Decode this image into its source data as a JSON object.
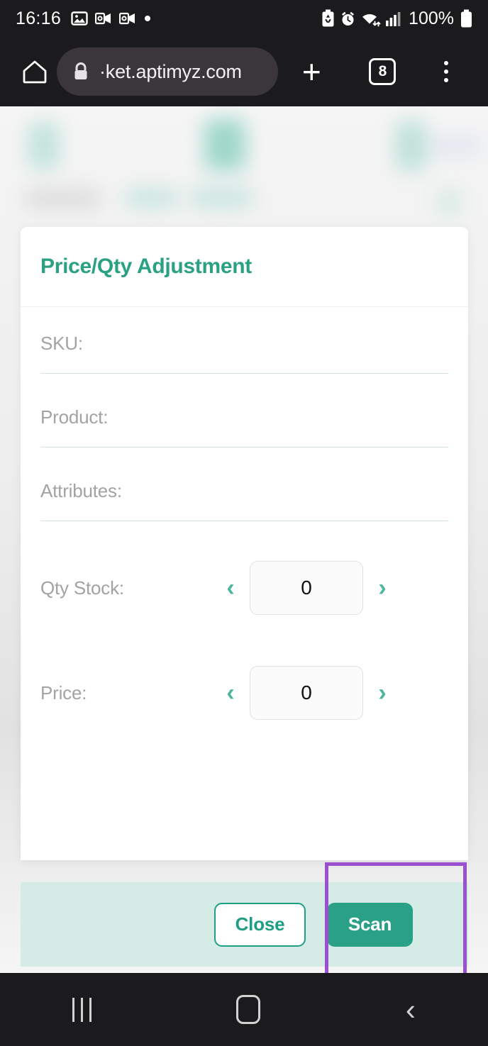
{
  "status_bar": {
    "clock": "16:16",
    "battery_percent": "100%",
    "left_icons": [
      "gallery-icon",
      "outlook-notification-icon",
      "outlook-notification-icon",
      "dot-indicator-icon"
    ],
    "right_icons": [
      "battery-saver-icon",
      "alarm-icon",
      "wifi-icon",
      "signal-icon",
      "battery-icon"
    ]
  },
  "browser": {
    "home_icon": "home-icon",
    "lock_icon": "lock-icon",
    "url": "·ket.aptimyz.com",
    "new_tab_label": "+",
    "tab_count": "8",
    "menu_icon": "kebab-menu-icon"
  },
  "modal": {
    "title": "Price/Qty Adjustment",
    "fields": [
      {
        "label": "SKU:",
        "value": ""
      },
      {
        "label": "Product:",
        "value": ""
      },
      {
        "label": "Attributes:",
        "value": ""
      }
    ],
    "steppers": [
      {
        "label": "Qty Stock:",
        "value": "0",
        "dec_icon": "chevron-left-icon",
        "inc_icon": "chevron-right-icon",
        "dec": "‹",
        "inc": "›"
      },
      {
        "label": "Price:",
        "value": "0",
        "dec_icon": "chevron-left-icon",
        "inc_icon": "chevron-right-icon",
        "dec": "‹",
        "inc": "›"
      }
    ],
    "footer": {
      "close_label": "Close",
      "scan_label": "Scan"
    }
  },
  "annotation": {
    "target": "scan-button",
    "color": "#9b51cf"
  },
  "colors": {
    "accent_teal": "#2aa187",
    "footer_bg": "#d5ebe6",
    "chevron_teal": "#4cb6a1",
    "label_gray": "#a3a3a3",
    "chrome_dark": "#1b1b1d"
  },
  "nav_bar": {
    "recents_icon": "recents-icon",
    "home_icon": "home-square-icon",
    "back_icon": "back-chevron-icon"
  }
}
